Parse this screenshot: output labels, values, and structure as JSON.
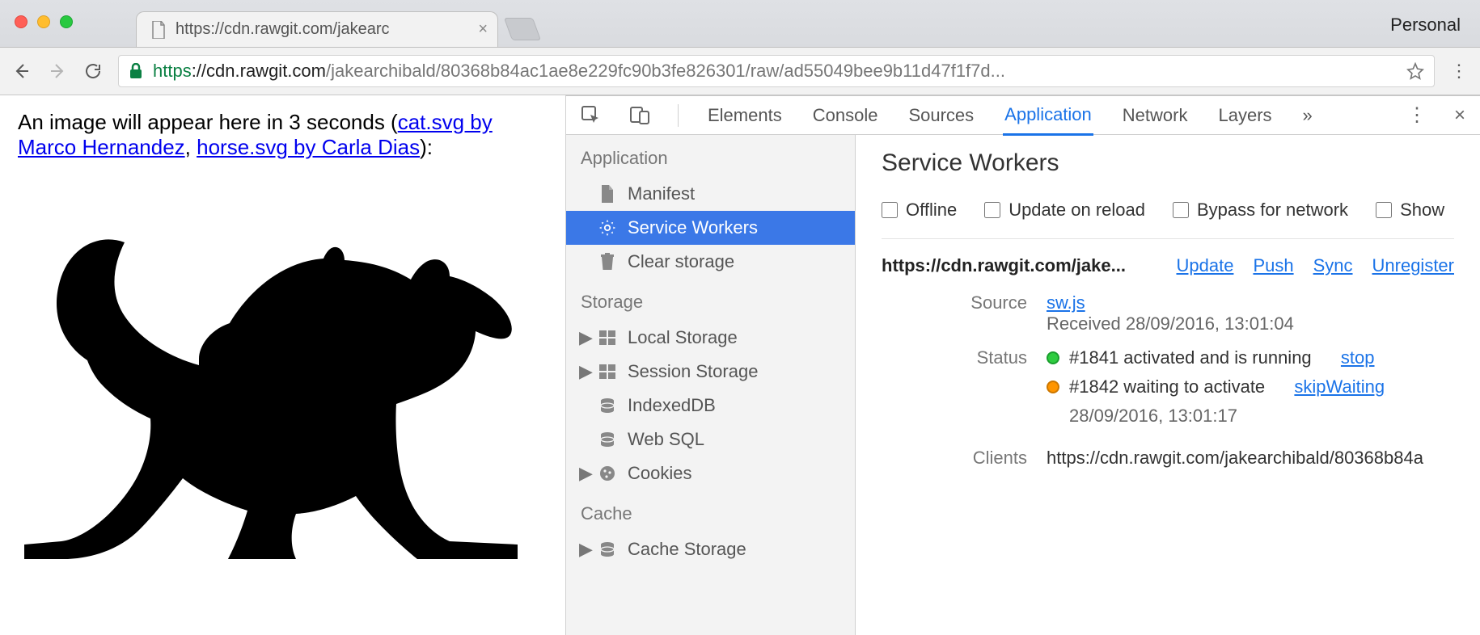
{
  "window": {
    "personal_label": "Personal",
    "tab_title": "https://cdn.rawgit.com/jakearc",
    "url_scheme": "https",
    "url_host": "://cdn.rawgit.com",
    "url_path": "/jakearchibald/80368b84ac1ae8e229fc90b3fe826301/raw/ad55049bee9b11d47f1f7d..."
  },
  "page": {
    "intro_prefix": "An image will appear here in 3 seconds (",
    "link1": "cat.svg by Marco Hernandez",
    "sep": ", ",
    "link2": "horse.svg by Carla Dias",
    "intro_suffix": "):"
  },
  "devtools": {
    "tabs": [
      "Elements",
      "Console",
      "Sources",
      "Application",
      "Network",
      "Layers"
    ],
    "active_tab": "Application",
    "overflow": "»"
  },
  "sidebar": {
    "sections": [
      {
        "title": "Application",
        "items": [
          {
            "label": "Manifest",
            "icon": "file-icon"
          },
          {
            "label": "Service Workers",
            "icon": "gear-icon",
            "selected": true
          },
          {
            "label": "Clear storage",
            "icon": "trash-icon"
          }
        ]
      },
      {
        "title": "Storage",
        "items": [
          {
            "label": "Local Storage",
            "icon": "storage-icon",
            "expandable": true
          },
          {
            "label": "Session Storage",
            "icon": "storage-icon",
            "expandable": true
          },
          {
            "label": "IndexedDB",
            "icon": "db-icon"
          },
          {
            "label": "Web SQL",
            "icon": "db-icon"
          },
          {
            "label": "Cookies",
            "icon": "cookie-icon",
            "expandable": true
          }
        ]
      },
      {
        "title": "Cache",
        "items": [
          {
            "label": "Cache Storage",
            "icon": "db-icon",
            "expandable": true
          }
        ]
      }
    ]
  },
  "sw": {
    "title": "Service Workers",
    "checks": [
      "Offline",
      "Update on reload",
      "Bypass for network",
      "Show"
    ],
    "scope": "https://cdn.rawgit.com/jake...",
    "actions": [
      "Update",
      "Push",
      "Sync",
      "Unregister"
    ],
    "source_label": "Source",
    "source_link": "sw.js",
    "received": "Received 28/09/2016, 13:01:04",
    "status_label": "Status",
    "status1": "#1841 activated and is running",
    "status1_action": "stop",
    "status2": "#1842 waiting to activate",
    "status2_action": "skipWaiting",
    "status2_time": "28/09/2016, 13:01:17",
    "clients_label": "Clients",
    "clients_value": "https://cdn.rawgit.com/jakearchibald/80368b84a"
  }
}
